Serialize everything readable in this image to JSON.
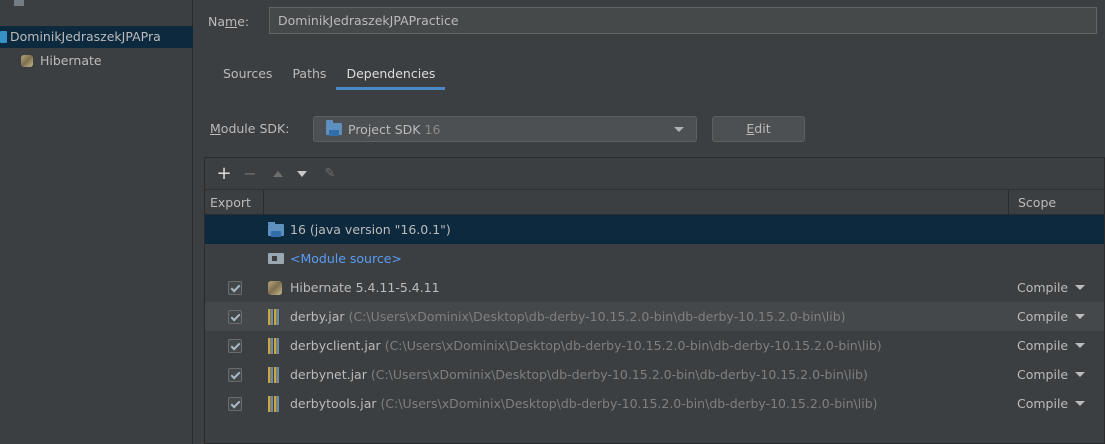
{
  "tree": {
    "module_name": "DominikJedraszekJPAPra",
    "facet_name": "Hibernate"
  },
  "name_field": {
    "label_prefix": "Na",
    "label_mnemonic": "m",
    "label_suffix": "e:",
    "value": "DominikJedraszekJPAPractice"
  },
  "tabs": [
    {
      "label": "Sources",
      "active": false
    },
    {
      "label": "Paths",
      "active": false
    },
    {
      "label": "Dependencies",
      "active": true
    }
  ],
  "sdk": {
    "label_mnemonic": "M",
    "label_rest": "odule SDK:",
    "selected_name": "Project SDK",
    "selected_version": "16",
    "edit_mnemonic": "E",
    "edit_rest": "dit"
  },
  "toolbar": {
    "add": "+",
    "remove": "−",
    "edit": "✎"
  },
  "table": {
    "header_export": "Export",
    "header_scope": "Scope",
    "rows": [
      {
        "name": "16 (java version \"16.0.1\")",
        "path": "",
        "scope": "",
        "checked": null,
        "icon": "jdk-folder-icon"
      },
      {
        "name": "<Module source>",
        "path": "",
        "scope": "",
        "checked": null,
        "icon": "module-source-icon"
      },
      {
        "name": "Hibernate 5.4.11-5.4.11",
        "path": "",
        "scope": "Compile",
        "checked": true,
        "icon": "hibernate-icon"
      },
      {
        "name": "derby.jar",
        "path": "(C:\\Users\\xDominix\\Desktop\\db-derby-10.15.2.0-bin\\db-derby-10.15.2.0-bin\\lib)",
        "scope": "Compile",
        "checked": true,
        "icon": "jar-icon"
      },
      {
        "name": "derbyclient.jar",
        "path": "(C:\\Users\\xDominix\\Desktop\\db-derby-10.15.2.0-bin\\db-derby-10.15.2.0-bin\\lib)",
        "scope": "Compile",
        "checked": true,
        "icon": "jar-icon"
      },
      {
        "name": "derbynet.jar",
        "path": "(C:\\Users\\xDominix\\Desktop\\db-derby-10.15.2.0-bin\\db-derby-10.15.2.0-bin\\lib)",
        "scope": "Compile",
        "checked": true,
        "icon": "jar-icon"
      },
      {
        "name": "derbytools.jar",
        "path": "(C:\\Users\\xDominix\\Desktop\\db-derby-10.15.2.0-bin\\db-derby-10.15.2.0-bin\\lib)",
        "scope": "Compile",
        "checked": true,
        "icon": "jar-icon"
      }
    ]
  },
  "colors": {
    "background": "#3c3f41",
    "selection": "#0d293e",
    "link": "#589df6",
    "tab_underline": "#4a88c7"
  }
}
